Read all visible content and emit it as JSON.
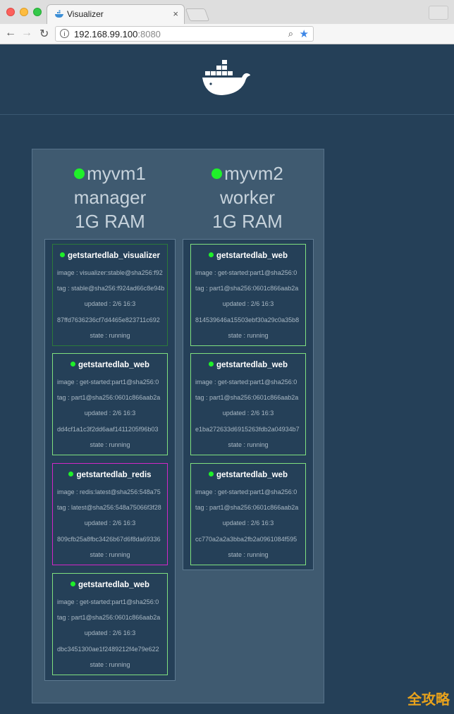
{
  "browser": {
    "tab_title": "Visualizer",
    "tab_close": "×",
    "url_host": "192.168.99.100",
    "url_port": ":8080",
    "icons": [
      "close-traffic-light-icon",
      "minimize-traffic-light-icon",
      "maximize-traffic-light-icon",
      "whale-favicon-icon",
      "back-arrow-icon",
      "forward-arrow-icon",
      "reload-icon",
      "info-icon",
      "zoom-icon",
      "bookmark-star-icon"
    ]
  },
  "colors": {
    "background": "#254058",
    "swarm_bg": "#3f5a70",
    "status_green": "#1ff02a",
    "task_border_running": "#7fe07f",
    "task_border_redis": "#d227c7"
  },
  "nodes": [
    {
      "name": "myvm1",
      "role": "manager",
      "ram": "1G RAM",
      "tasks": [
        {
          "name": "getstartedlab_visualizer",
          "image": "image : visualizer:stable@sha256:f92",
          "tag": "tag : stable@sha256:f924ad66c8e94b",
          "updated": "updated : 2/6 16:3",
          "id": "87ffd7636236cf7d4465e823711c692",
          "state": "state : running"
        },
        {
          "name": "getstartedlab_web",
          "image": "image : get-started:part1@sha256:0",
          "tag": "tag : part1@sha256:0601c866aab2a",
          "updated": "updated : 2/6 16:3",
          "id": "dd4cf1a1c3f2dd6aaf1411205f96b03",
          "state": "state : running"
        },
        {
          "name": "getstartedlab_redis",
          "image": "image : redis:latest@sha256:548a75",
          "tag": "tag : latest@sha256:548a75066f3f28",
          "updated": "updated : 2/6 16:3",
          "id": "809cfb25a8fbc3426b67d6f8da69336",
          "state": "state : running"
        },
        {
          "name": "getstartedlab_web",
          "image": "image : get-started:part1@sha256:0",
          "tag": "tag : part1@sha256:0601c866aab2a",
          "updated": "updated : 2/6 16:3",
          "id": "dbc3451300ae1f2489212f4e79e622",
          "state": "state : running"
        }
      ]
    },
    {
      "name": "myvm2",
      "role": "worker",
      "ram": "1G RAM",
      "tasks": [
        {
          "name": "getstartedlab_web",
          "image": "image : get-started:part1@sha256:0",
          "tag": "tag : part1@sha256:0601c866aab2a",
          "updated": "updated : 2/6 16:3",
          "id": "814539646a15503ebf30a29c0a35b8",
          "state": "state : running"
        },
        {
          "name": "getstartedlab_web",
          "image": "image : get-started:part1@sha256:0",
          "tag": "tag : part1@sha256:0601c866aab2a",
          "updated": "updated : 2/6 16:3",
          "id": "e1ba272633d6915263fdb2a04934b7",
          "state": "state : running"
        },
        {
          "name": "getstartedlab_web",
          "image": "image : get-started:part1@sha256:0",
          "tag": "tag : part1@sha256:0601c866aab2a",
          "updated": "updated : 2/6 16:3",
          "id": "cc770a2a2a3bba2fb2a0961084f595",
          "state": "state : running"
        }
      ]
    }
  ],
  "watermark": "全攻略"
}
